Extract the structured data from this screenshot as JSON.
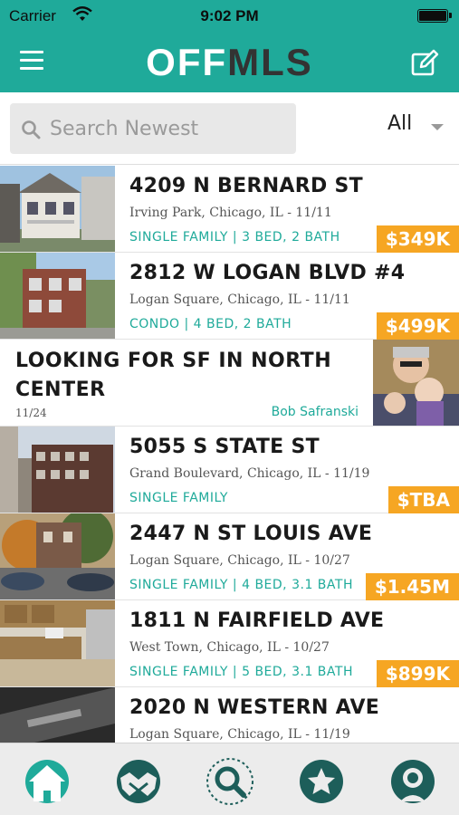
{
  "status_bar": {
    "carrier": "Carrier",
    "time": "9:02 PM"
  },
  "nav": {
    "logo_part1": "OFF",
    "logo_part2": "MLS"
  },
  "search": {
    "placeholder": "Search Newest",
    "filter_value": "All"
  },
  "colors": {
    "brand": "#1faa9a",
    "price": "#f6a623",
    "text": "#1a1a1a"
  },
  "listings": [
    {
      "address": "4209 N BERNARD ST",
      "location": "Irving Park, Chicago, IL  -  11/11",
      "details": "SINGLE FAMILY | 3 BED, 2 BATH",
      "price": "$349K"
    },
    {
      "address": "2812 W LOGAN BLVD #4",
      "location": "Logan Square, Chicago, IL  -  11/11",
      "details": "CONDO | 4 BED, 2 BATH",
      "price": "$499K"
    },
    {
      "address": "5055 S STATE ST",
      "location": "Grand Boulevard, Chicago, IL  -  11/19",
      "details": "SINGLE FAMILY",
      "price": "$TBA"
    },
    {
      "address": "2447 N ST LOUIS AVE",
      "location": "Logan Square, Chicago, IL  -  10/27",
      "details": "SINGLE FAMILY | 4 BED, 3.1 BATH",
      "price": "$1.45M"
    },
    {
      "address": "1811 N FAIRFIELD AVE",
      "location": "West Town, Chicago, IL  -  10/27",
      "details": "SINGLE FAMILY | 5 BED, 3.1 BATH",
      "price": "$899K"
    },
    {
      "address": "2020 N WESTERN AVE",
      "location": "Logan Square, Chicago, IL  -  11/19",
      "details": "",
      "price": ""
    }
  ],
  "wanted": {
    "title": "LOOKING FOR SF IN NORTH CENTER",
    "date": "11/24",
    "author": "Bob Safranski"
  },
  "tabs": [
    {
      "icon": "home-icon"
    },
    {
      "icon": "handshake-icon"
    },
    {
      "icon": "search-icon"
    },
    {
      "icon": "star-icon"
    },
    {
      "icon": "profile-icon"
    }
  ]
}
